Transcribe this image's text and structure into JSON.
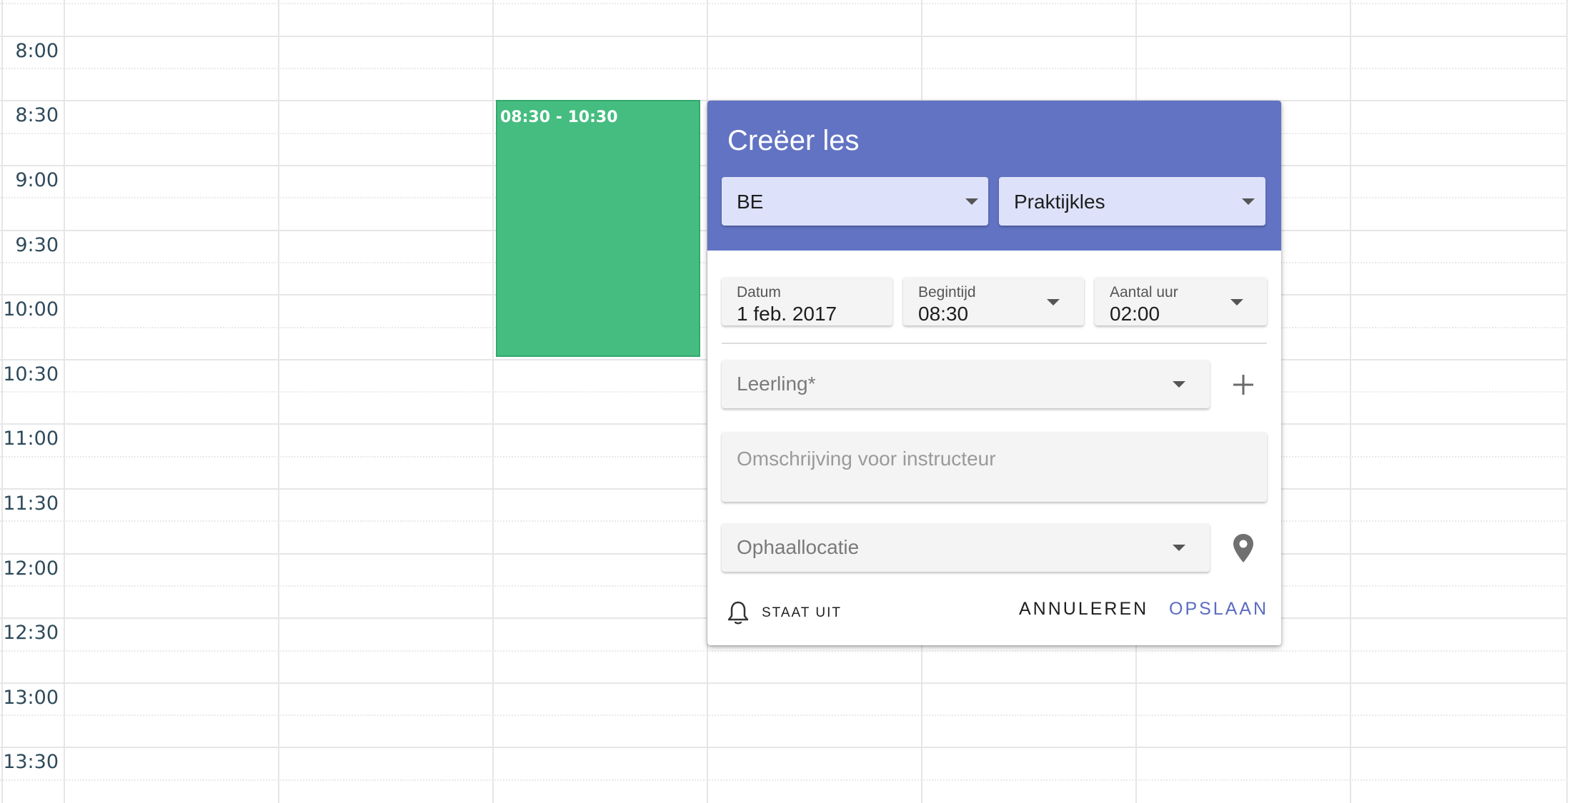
{
  "calendar": {
    "time_labels": [
      "8:00",
      "8:30",
      "9:00",
      "9:30",
      "10:00",
      "10:30",
      "11:00",
      "11:30",
      "12:00",
      "12:30",
      "13:00",
      "13:30"
    ],
    "event": {
      "time_range": "08:30 - 10:30",
      "color": "#45bd80"
    }
  },
  "dialog": {
    "title": "Creëer les",
    "header_color": "#6273c3",
    "country_select": {
      "value": "BE"
    },
    "type_select": {
      "value": "Praktijkles"
    },
    "date_field": {
      "label": "Datum",
      "value": "1 feb. 2017"
    },
    "start_time_field": {
      "label": "Begintijd",
      "value": "08:30"
    },
    "hours_field": {
      "label": "Aantal uur",
      "value": "02:00"
    },
    "student_field": {
      "placeholder": "Leerling*"
    },
    "description_field": {
      "placeholder": "Omschrijving voor instructeur"
    },
    "pickup_field": {
      "placeholder": "Ophaallocatie"
    },
    "notification_label": "STAAT UIT",
    "cancel_label": "ANNULEREN",
    "save_label": "OPSLAAN",
    "accent_color": "#5c6bc0",
    "icons": {
      "add": "plus-icon",
      "location": "map-pin-icon",
      "notification": "bell-icon",
      "dropdown": "chevron-down-icon"
    }
  }
}
